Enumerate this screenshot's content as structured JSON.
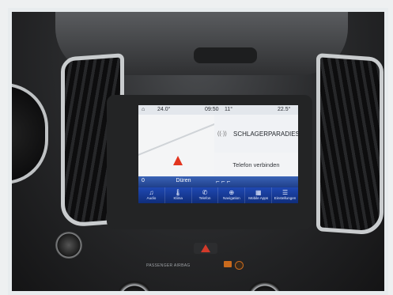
{
  "status_bar": {
    "home_icon": "home-icon",
    "outside_temp": "24.0°",
    "time": "09:50",
    "time_extra": "11°",
    "cabin_temp": "22.5°"
  },
  "media": {
    "source_icon": "radio-icon",
    "station": "SCHLAGERPARADIES"
  },
  "phone": {
    "status": "Telefon verbinden"
  },
  "climate": {
    "left_value": "0",
    "city": "Düren"
  },
  "nav": {
    "items": [
      {
        "icon": "music-note-icon",
        "glyph": "♫",
        "label": "Audio"
      },
      {
        "icon": "thermometer-icon",
        "glyph": "🌡",
        "label": "Klima"
      },
      {
        "icon": "phone-icon",
        "glyph": "✆",
        "label": "Telefon"
      },
      {
        "icon": "navigation-icon",
        "glyph": "⊕",
        "label": "Navigation"
      },
      {
        "icon": "apps-grid-icon",
        "glyph": "▦",
        "label": "Mobile Apps"
      },
      {
        "icon": "settings-sliders-icon",
        "glyph": "☰",
        "label": "Einstellungen"
      }
    ]
  },
  "console": {
    "airbag_label": "PASSENGER AIRBAG"
  },
  "colors": {
    "nav_blue": "#1f48b2",
    "hazard_red": "#d23a2a",
    "airbag_orange": "#c96a1d"
  }
}
